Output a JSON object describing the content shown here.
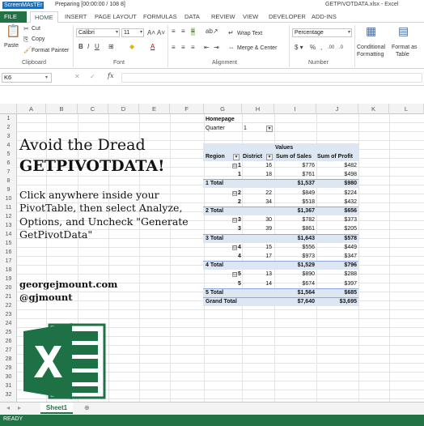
{
  "recorder": {
    "logo": "ScreenMAsTEr",
    "status": "Preparing  [00:00:00 / 108 8]"
  },
  "window": {
    "title": "GETPIVOTDATA.xlsx - Excel"
  },
  "ribbon": {
    "tabs": [
      "FILE",
      "HOME",
      "INSERT",
      "PAGE LAYOUT",
      "FORMULAS",
      "DATA",
      "REVIEW",
      "VIEW",
      "DEVELOPER",
      "ADD-INS"
    ],
    "active_tab": "HOME",
    "clipboard": {
      "paste": "Paste",
      "cut": "Cut",
      "copy": "Copy",
      "format_painter": "Format Painter",
      "group": "Clipboard"
    },
    "font": {
      "name": "Calibri",
      "size": "11",
      "group": "Font"
    },
    "alignment": {
      "wrap_text": "Wrap Text",
      "merge_center": "Merge & Center",
      "group": "Alignment"
    },
    "number": {
      "format": "Percentage",
      "group": "Number"
    },
    "styles": {
      "conditional": "Conditional",
      "formatting": "Formatting",
      "format_as": "Format as",
      "table": "Table"
    }
  },
  "formula_bar": {
    "name_box": "K6",
    "fx": "fx"
  },
  "columns": [
    "A",
    "B",
    "C",
    "D",
    "E",
    "F",
    "G",
    "H",
    "I",
    "J",
    "K",
    "L"
  ],
  "rows": [
    "1",
    "2",
    "3",
    "4",
    "5",
    "6",
    "7",
    "8",
    "9",
    "10",
    "11",
    "12",
    "13",
    "14",
    "15",
    "16",
    "17",
    "18",
    "19",
    "20",
    "21",
    "22",
    "23",
    "24",
    "25",
    "26",
    "27",
    "28",
    "29",
    "30",
    "31",
    "32"
  ],
  "content": {
    "headline_line1": "Avoid the Dread",
    "headline_line2": "GETPIVOTDATA!",
    "instruction_lines": [
      "Click anywhere inside your",
      "PivotTable, then select Analyze,",
      "Options, and Uncheck \"Generate",
      "GetPivotData\""
    ],
    "contact_site": "georgejmount.com",
    "contact_handle": "@gjmount"
  },
  "pivot": {
    "filter_label": "Homepage",
    "filter_field": "Quarter",
    "filter_value": "1",
    "values_header": "Values",
    "headers": [
      "Region",
      "District",
      "Sum of Sales",
      "Sum of Profit"
    ],
    "rows": [
      {
        "region": "1",
        "district": "16",
        "sales": "$776",
        "profit": "$482",
        "kind": "group"
      },
      {
        "region": "1",
        "district": "18",
        "sales": "$761",
        "profit": "$498",
        "kind": "detail"
      },
      {
        "region": "1 Total",
        "district": "",
        "sales": "$1,537",
        "profit": "$980",
        "kind": "total"
      },
      {
        "region": "2",
        "district": "22",
        "sales": "$849",
        "profit": "$224",
        "kind": "group"
      },
      {
        "region": "2",
        "district": "34",
        "sales": "$518",
        "profit": "$432",
        "kind": "detail"
      },
      {
        "region": "2 Total",
        "district": "",
        "sales": "$1,367",
        "profit": "$656",
        "kind": "total"
      },
      {
        "region": "3",
        "district": "30",
        "sales": "$782",
        "profit": "$373",
        "kind": "group"
      },
      {
        "region": "3",
        "district": "39",
        "sales": "$861",
        "profit": "$205",
        "kind": "detail"
      },
      {
        "region": "3 Total",
        "district": "",
        "sales": "$1,643",
        "profit": "$578",
        "kind": "total"
      },
      {
        "region": "4",
        "district": "15",
        "sales": "$556",
        "profit": "$449",
        "kind": "group"
      },
      {
        "region": "4",
        "district": "17",
        "sales": "$973",
        "profit": "$347",
        "kind": "detail"
      },
      {
        "region": "4 Total",
        "district": "",
        "sales": "$1,529",
        "profit": "$796",
        "kind": "total"
      },
      {
        "region": "5",
        "district": "13",
        "sales": "$890",
        "profit": "$288",
        "kind": "group"
      },
      {
        "region": "5",
        "district": "14",
        "sales": "$674",
        "profit": "$397",
        "kind": "detail"
      },
      {
        "region": "5 Total",
        "district": "",
        "sales": "$1,564",
        "profit": "$685",
        "kind": "total"
      },
      {
        "region": "Grand Total",
        "district": "",
        "sales": "$7,640",
        "profit": "$3,695",
        "kind": "grand"
      }
    ]
  },
  "sheet": {
    "tab": "Sheet1"
  },
  "status": {
    "ready": "READY"
  },
  "colors": {
    "excel_green": "#217346",
    "pivot_band": "#dde7f3"
  }
}
